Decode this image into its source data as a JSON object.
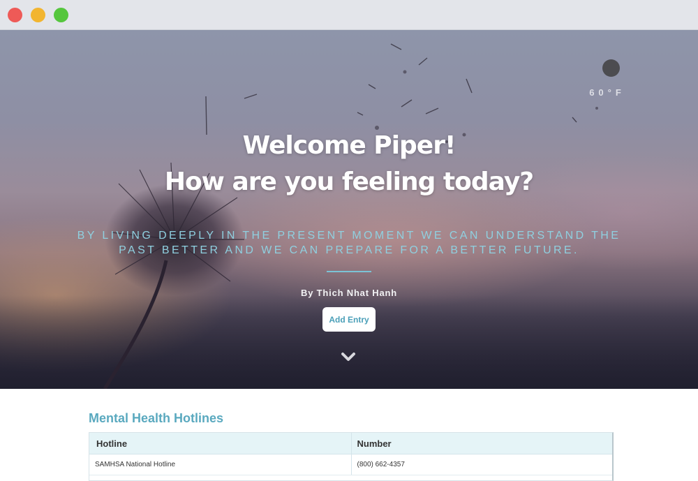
{
  "window": {
    "controls": [
      "close",
      "minimize",
      "maximize"
    ]
  },
  "weather": {
    "icon": "weather-icon",
    "temperature": "60°F"
  },
  "hero": {
    "greeting": "Welcome Piper!",
    "question": "How are you feeling today?",
    "quote_line1": "BY LIVING DEEPLY IN THE PRESENT MOMENT WE CAN UNDERSTAND THE",
    "quote_line2": "PAST BETTER AND WE CAN PREPARE FOR A BETTER FUTURE.",
    "author": "By Thich Nhat Hanh",
    "add_entry_label": "Add Entry",
    "scroll_icon": "chevron-down-icon"
  },
  "hotlines": {
    "title": "Mental Health Hotlines",
    "columns": [
      "Hotline",
      "Number"
    ],
    "rows": [
      {
        "hotline": "SAMHSA National Hotline",
        "number": "(800) 662-4357"
      }
    ]
  },
  "colors": {
    "accent": "#5aa9bf",
    "quote": "#8fd0e0",
    "table_header_bg": "#e5f4f7"
  }
}
